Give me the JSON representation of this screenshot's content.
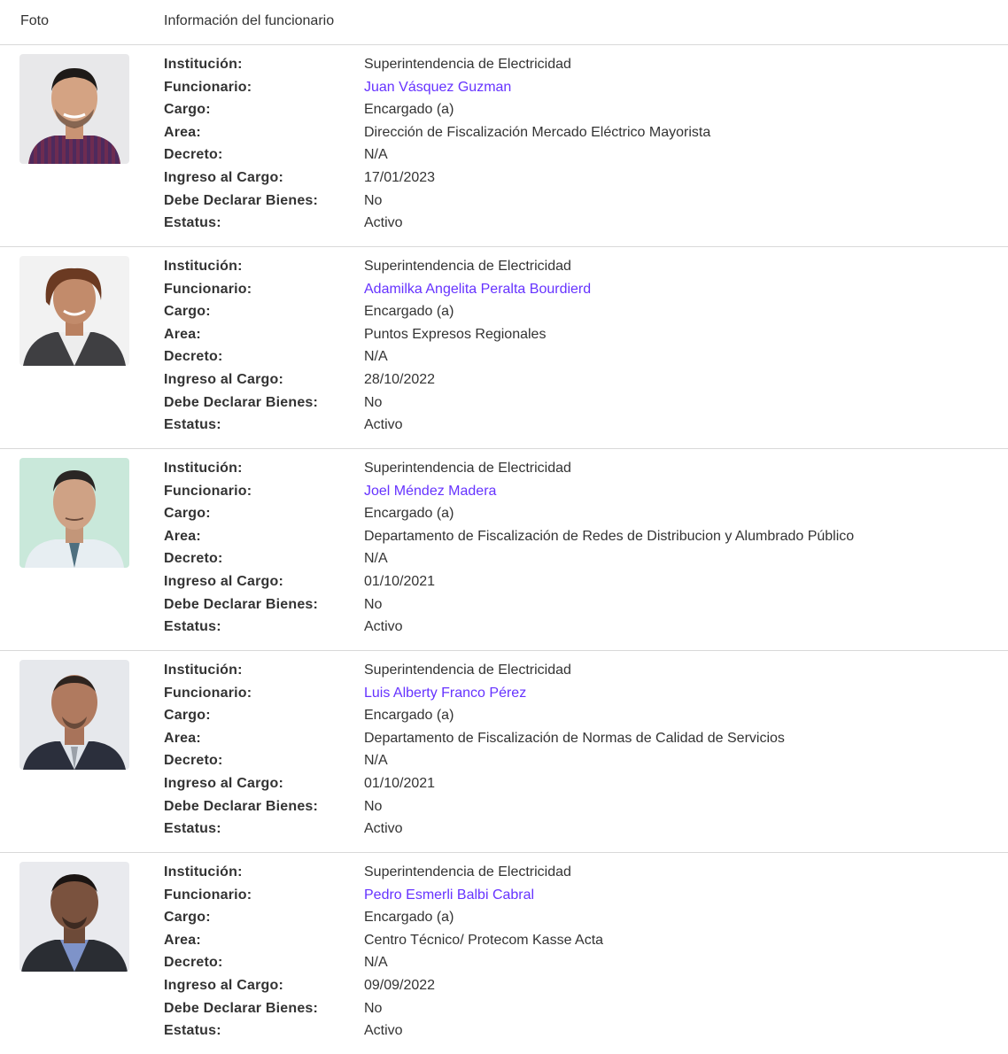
{
  "header": {
    "foto": "Foto",
    "info": "Información del funcionario"
  },
  "labels": {
    "institucion": "Institución:",
    "funcionario": "Funcionario:",
    "cargo": "Cargo:",
    "area": "Area:",
    "decreto": "Decreto:",
    "ingreso": "Ingreso al Cargo:",
    "declarar": "Debe Declarar Bienes:",
    "estatus": "Estatus:"
  },
  "rows": [
    {
      "institucion": "Superintendencia de Electricidad",
      "funcionario": "Juan Vásquez Guzman",
      "cargo": "Encargado (a)",
      "area": "Dirección de Fiscalización Mercado Eléctrico Mayorista",
      "decreto": "N/A",
      "ingreso": "17/01/2023",
      "declarar": "No",
      "estatus": "Activo"
    },
    {
      "institucion": "Superintendencia de Electricidad",
      "funcionario": "Adamilka Angelita Peralta Bourdierd",
      "cargo": "Encargado (a)",
      "area": "Puntos Expresos Regionales",
      "decreto": "N/A",
      "ingreso": "28/10/2022",
      "declarar": "No",
      "estatus": "Activo"
    },
    {
      "institucion": "Superintendencia de Electricidad",
      "funcionario": "Joel Méndez Madera",
      "cargo": "Encargado (a)",
      "area": "Departamento de Fiscalización de Redes de Distribucion y Alumbrado Público",
      "decreto": "N/A",
      "ingreso": "01/10/2021",
      "declarar": "No",
      "estatus": "Activo"
    },
    {
      "institucion": "Superintendencia de Electricidad",
      "funcionario": "Luis Alberty Franco Pérez",
      "cargo": "Encargado (a)",
      "area": "Departamento de Fiscalización de Normas de Calidad de Servicios",
      "decreto": "N/A",
      "ingreso": "01/10/2021",
      "declarar": "No",
      "estatus": "Activo"
    },
    {
      "institucion": "Superintendencia de Electricidad",
      "funcionario": "Pedro Esmerli Balbi Cabral",
      "cargo": "Encargado (a)",
      "area": "Centro Técnico/ Protecom Kasse Acta",
      "decreto": "N/A",
      "ingreso": "09/09/2022",
      "declarar": "No",
      "estatus": "Activo"
    }
  ],
  "colors": {
    "link": "#6633ff",
    "text": "#333333",
    "divider": "#d9d9d9"
  }
}
